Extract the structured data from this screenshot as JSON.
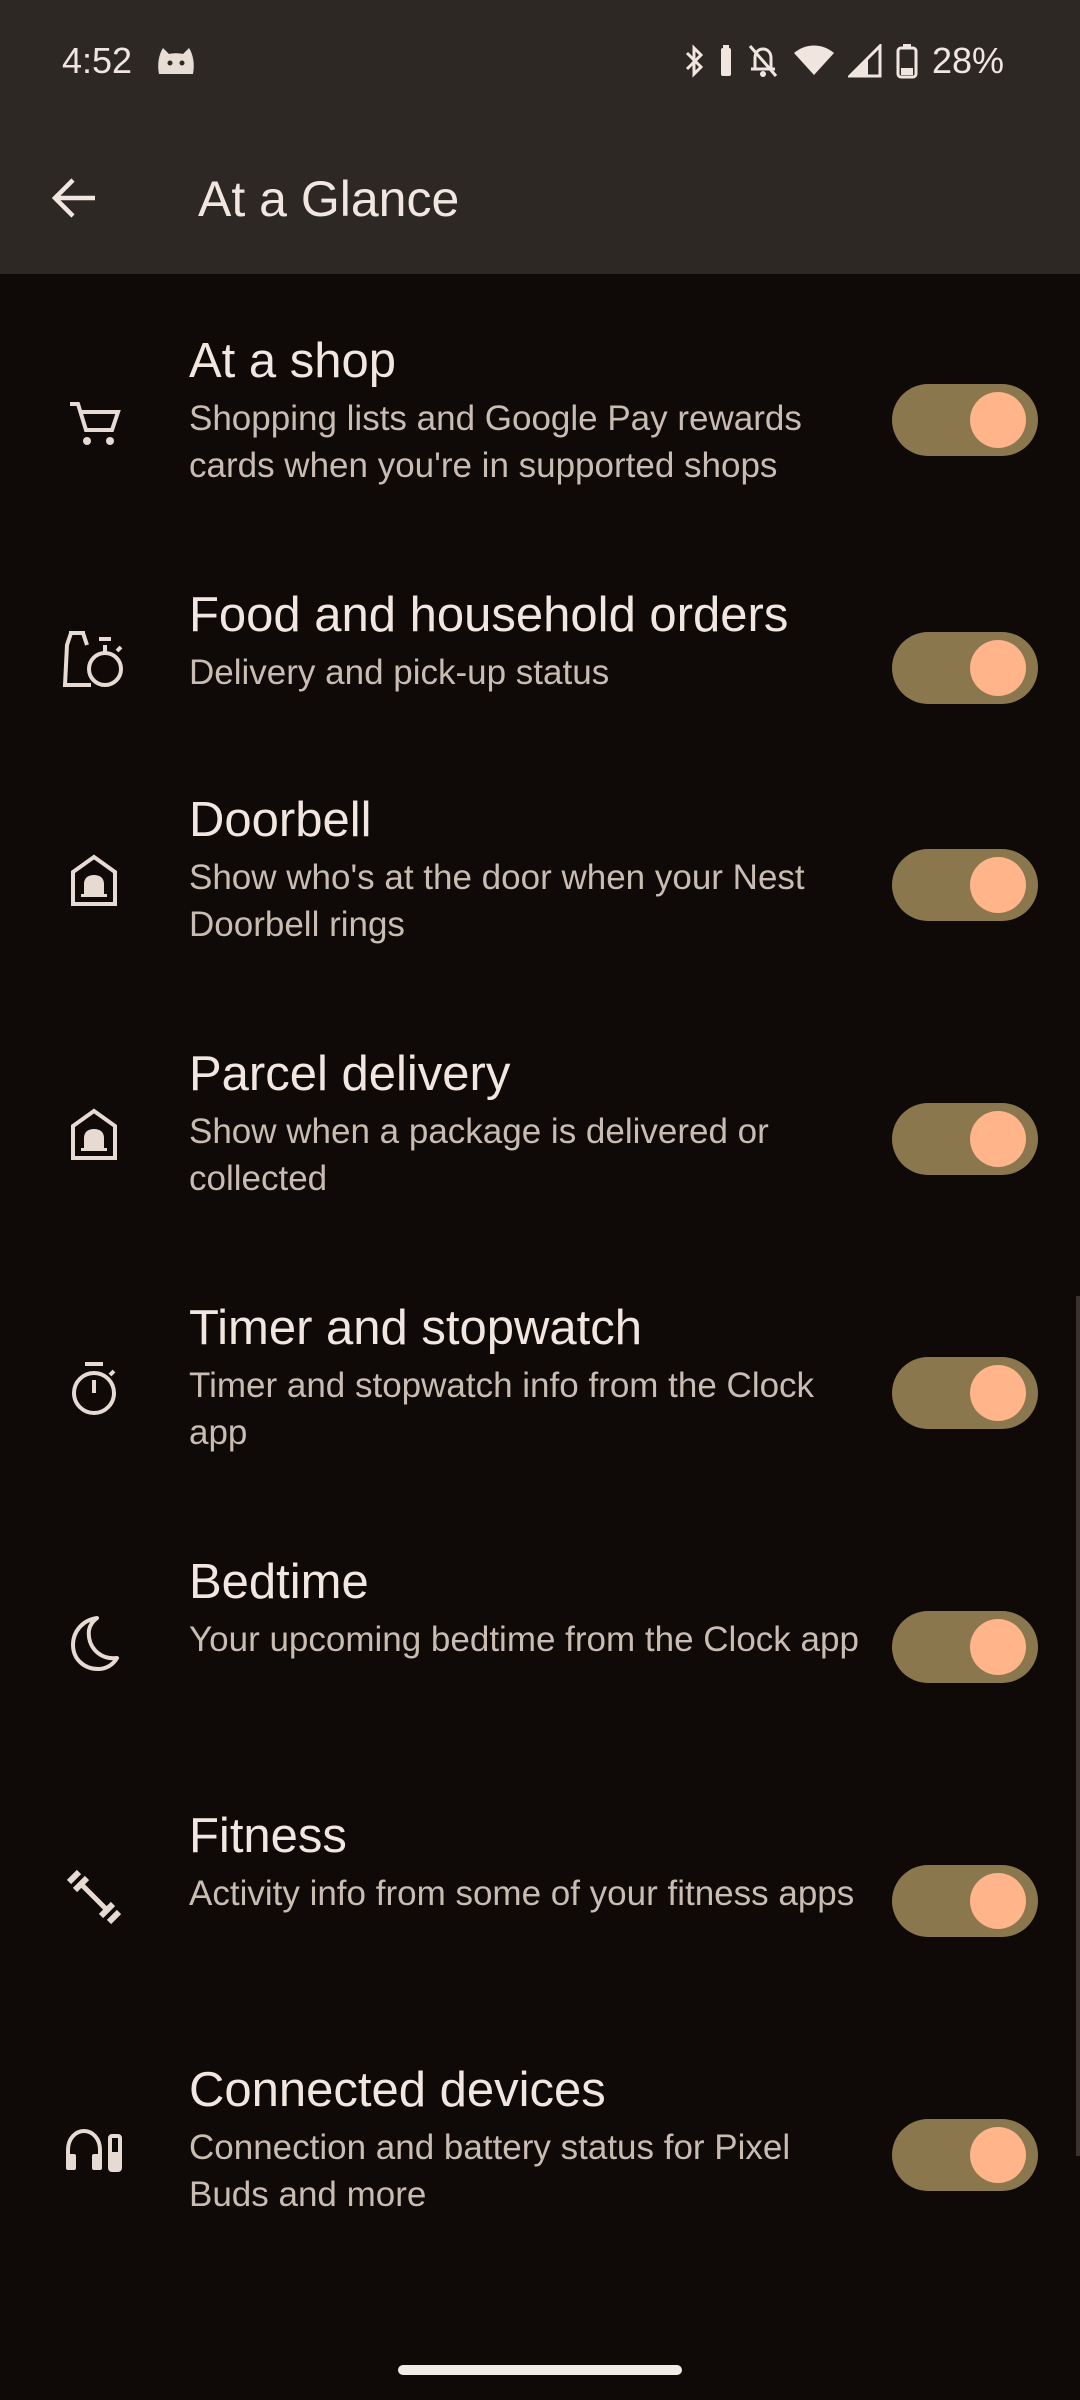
{
  "status_bar": {
    "time": "4:52",
    "battery": "28%"
  },
  "app_bar": {
    "title": "At a Glance",
    "back_icon": "arrow-back-icon"
  },
  "items": [
    {
      "title": "At a shop",
      "subtitle": "Shopping lists and Google Pay rewards cards when you're in supported shops",
      "icon": "shopping-cart-icon",
      "enabled": true
    },
    {
      "title": "Food and household orders",
      "subtitle": "Delivery and pick-up status",
      "icon": "grocery-bag-icon",
      "enabled": true
    },
    {
      "title": "Doorbell",
      "subtitle": "Show who's at the door when your Nest Doorbell rings",
      "icon": "doorbell-icon",
      "enabled": true
    },
    {
      "title": "Parcel delivery",
      "subtitle": "Show when a package is delivered or collected",
      "icon": "doorbell-icon",
      "enabled": true
    },
    {
      "title": "Timer and stopwatch",
      "subtitle": "Timer and stopwatch info from the Clock app",
      "icon": "timer-icon",
      "enabled": true
    },
    {
      "title": "Bedtime",
      "subtitle": "Your upcoming bedtime from the Clock app",
      "icon": "moon-icon",
      "enabled": true
    },
    {
      "title": "Fitness",
      "subtitle": "Activity info from some of your fitness apps",
      "icon": "fitness-icon",
      "enabled": true
    },
    {
      "title": "Connected devices",
      "subtitle": "Connection and battery status for Pixel Buds and more",
      "icon": "headphones-battery-icon",
      "enabled": true
    }
  ],
  "colors": {
    "background": "#0f0a07",
    "app_bar": "#2e2824",
    "switch_track_on": "#8a774e",
    "switch_thumb_on": "#ffb48a",
    "title_text": "#f2e7e0",
    "subtitle_text": "#c9bcb2"
  }
}
